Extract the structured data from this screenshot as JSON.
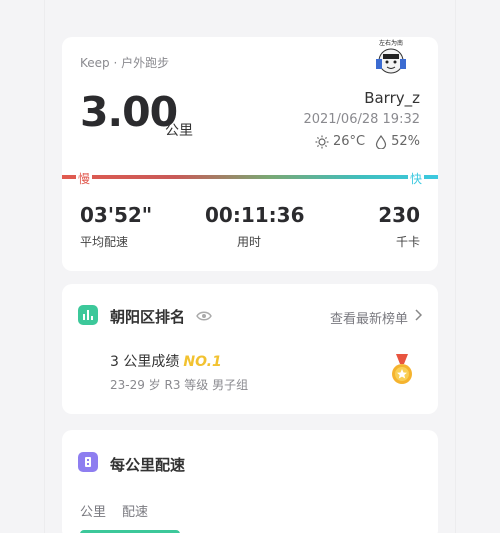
{
  "summary": {
    "source": "Keep · 户外跑步",
    "distance": "3.00",
    "distance_unit": "公里",
    "username": "Barry_z",
    "datetime": "2021/06/28 19:32",
    "temperature": "26°C",
    "humidity": "52%",
    "slow_label": "慢",
    "fast_label": "快",
    "avatar_caption": "左右为南",
    "stats": [
      {
        "value": "03'52\"",
        "label": "平均配速"
      },
      {
        "value": "00:11:36",
        "label": "用时"
      },
      {
        "value": "230",
        "label": "千卡"
      }
    ]
  },
  "ranking": {
    "title": "朝阳区排名",
    "link": "查看最新榜单",
    "result_label": "3 公里成绩",
    "rank": "NO.1",
    "group": "23-29 岁 R3 等级 男子组"
  },
  "perkm": {
    "title": "每公里配速",
    "columns": [
      "公里",
      "配速"
    ]
  },
  "colors": {
    "accent_green": "#3cc89a",
    "accent_purple": "#8e7ef0",
    "slow_red": "#e15a4f",
    "fast_cyan": "#3cc9e0",
    "gold": "#f2c230"
  }
}
